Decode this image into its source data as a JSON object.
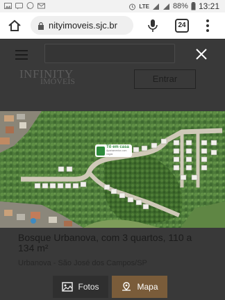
{
  "status_bar": {
    "battery": "88%",
    "time": "13:21",
    "network": "LTE"
  },
  "browser": {
    "url": "nityimoveis.sjc.br",
    "tabs_count": "24"
  },
  "header": {
    "logo_main": "INFINITY",
    "logo_sub": "IMÓVEIS",
    "enter_label": "Entrar"
  },
  "badge": {
    "text": "Tô em casa",
    "sub": "Apartamentos com vagas"
  },
  "listing": {
    "title": "Bosque Urbanova, com 3 quartos, 110 a 134 m²",
    "location": "Urbanova - São José dos Campos/SP"
  },
  "actions": {
    "photos_label": "Fotos",
    "map_label": "Mapa"
  },
  "colors": {
    "map_button": "#7a5c3a",
    "overlay": "#2a2a2a",
    "badge_green": "#2e8b3c"
  }
}
